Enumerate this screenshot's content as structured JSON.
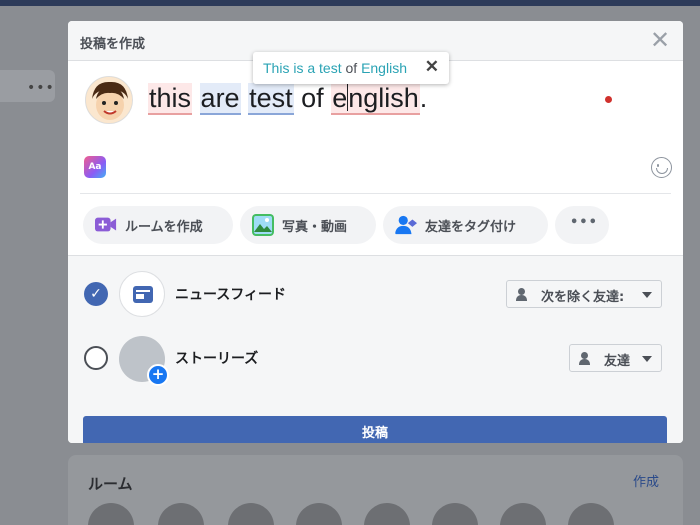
{
  "modal": {
    "title": "投稿を作成",
    "close_symbol": "✕"
  },
  "tooltip": {
    "word1": "This is a test",
    "word2": "of",
    "word3": "English",
    "close_symbol": "✕"
  },
  "composer": {
    "words": [
      "this",
      "are",
      "test",
      "of",
      "e",
      "nglish",
      "."
    ],
    "text_format_icon_label": "Aa"
  },
  "actions": [
    {
      "label": "ルームを作成",
      "icon": "room-video-icon"
    },
    {
      "label": "写真・動画",
      "icon": "photo-icon"
    },
    {
      "label": "友達をタグ付け",
      "icon": "tag-friend-icon"
    },
    {
      "label": "•••",
      "icon": "more-icon"
    }
  ],
  "targets": {
    "news_feed": {
      "label": "ニュースフィード",
      "checked": true,
      "audience": "次を除く友達:"
    },
    "stories": {
      "label": "ストーリーズ",
      "checked": false,
      "audience": "友達"
    }
  },
  "post_button": "投稿",
  "background": {
    "more_dots": "•••",
    "rooms_title": "ルーム",
    "rooms_create": "作成"
  },
  "colors": {
    "brand": "#4267b2",
    "accent": "#2aa3b4",
    "spell_red": "#fde8e8",
    "grammar_blue": "#e3ebf8"
  }
}
